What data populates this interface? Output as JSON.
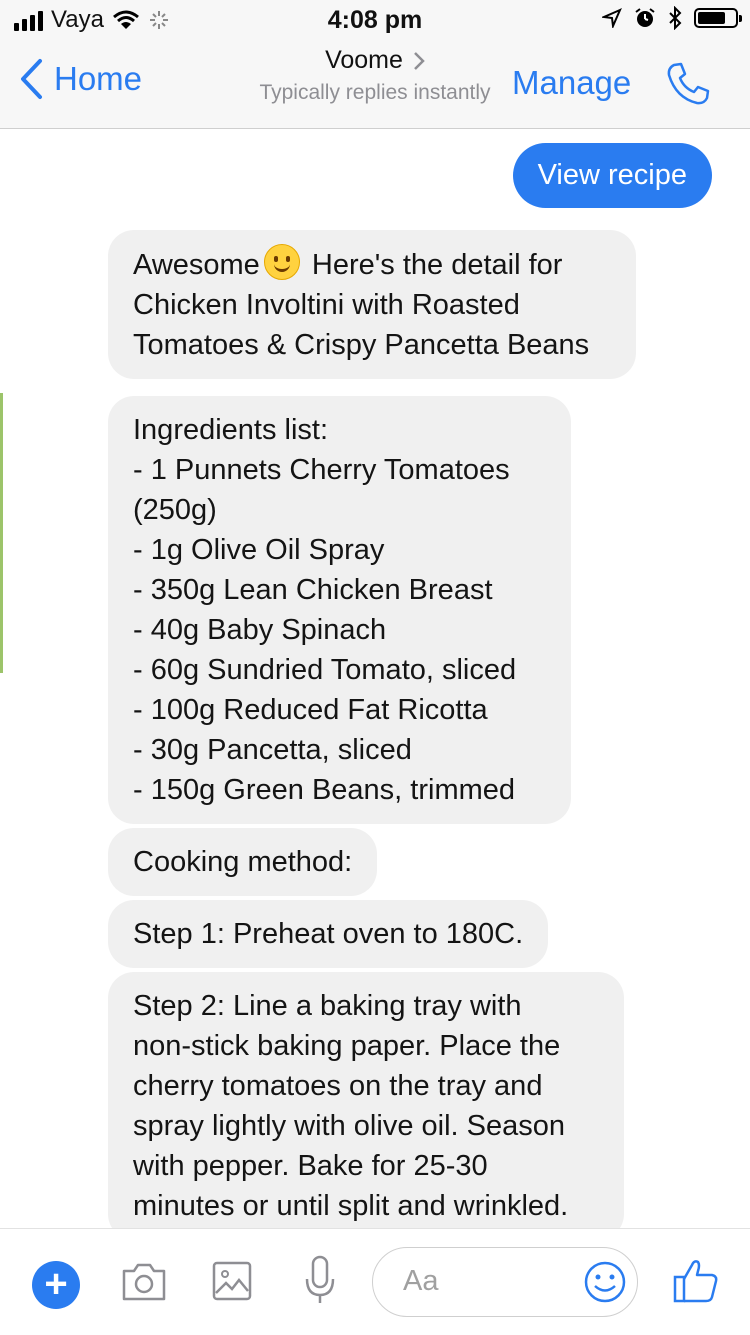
{
  "status_bar": {
    "carrier": "Vaya",
    "time": "4:08 pm",
    "battery_level": 0.75
  },
  "nav": {
    "back_label": "Home",
    "title": "Voome",
    "subtitle": "Typically replies instantly",
    "manage_label": "Manage"
  },
  "messages": {
    "outgoing_button": "View recipe",
    "intro": {
      "lead": "Awesome",
      "after_emoji": " Here's the detail for",
      "line2": "Chicken Involtini with Roasted",
      "line3": "Tomatoes & Crispy Pancetta Beans"
    },
    "ingredients": [
      "Ingredients list:",
      "- 1 Punnets Cherry Tomatoes",
      "(250g)",
      "- 1g Olive Oil Spray",
      "- 350g Lean Chicken Breast",
      "- 40g Baby Spinach",
      "- 60g Sundried Tomato, sliced",
      "- 100g Reduced Fat Ricotta",
      "- 30g Pancetta, sliced",
      "- 150g Green Beans, trimmed"
    ],
    "cooking_method": "Cooking method:",
    "step1": "Step 1:  Preheat  oven to 180C.",
    "step2": [
      "Step 2:  Line a baking tray with",
      "non-stick baking paper. Place the",
      "cherry tomatoes on the tray and",
      "spray lightly with olive oil. Season",
      "with pepper. Bake for 25-30",
      "minutes or until split and wrinkled."
    ]
  },
  "composer": {
    "placeholder": "Aa"
  },
  "colors": {
    "accent": "#2a7cf0",
    "incoming_bubble": "#f0f0f0",
    "bar_bg": "#f7f7f7"
  },
  "icons": [
    "signal-icon",
    "wifi-icon",
    "activity-icon",
    "location-icon",
    "alarm-icon",
    "bluetooth-icon",
    "battery-icon",
    "back-chevron-icon",
    "chevron-right-icon",
    "phone-icon",
    "plus-icon",
    "camera-icon",
    "image-icon",
    "microphone-icon",
    "smiley-icon",
    "thumbs-up-icon"
  ]
}
